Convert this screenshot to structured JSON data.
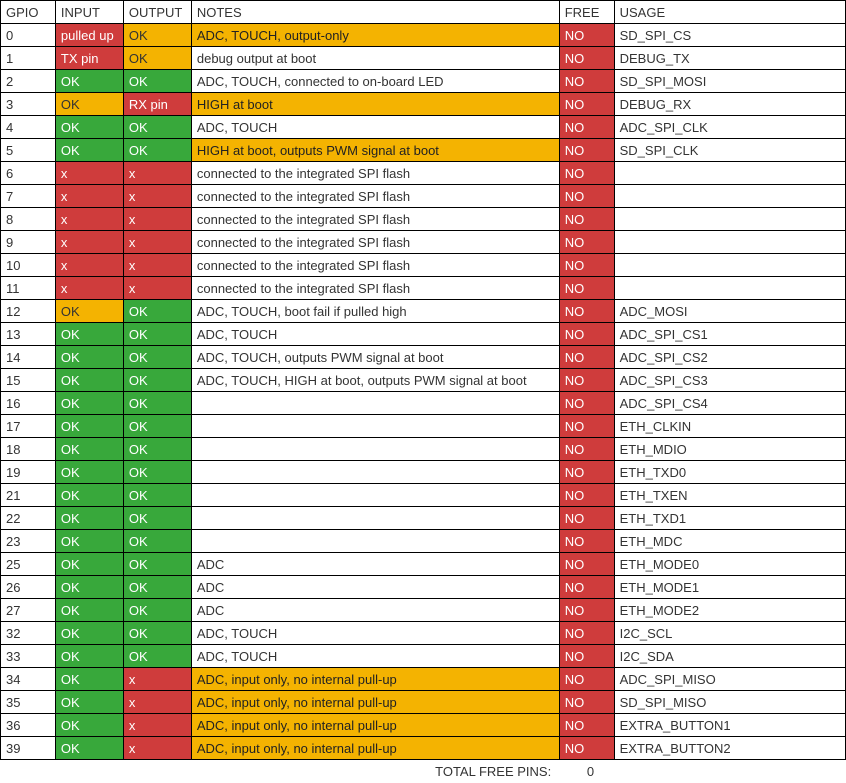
{
  "headers": {
    "gpio": "GPIO",
    "input": "INPUT",
    "output": "OUTPUT",
    "notes": "NOTES",
    "free": "FREE",
    "usage": "USAGE"
  },
  "rows": [
    {
      "gpio": "0",
      "input": "pulled up",
      "input_c": "red",
      "output": "OK",
      "output_c": "yellow",
      "notes": "ADC, TOUCH, output-only",
      "notes_c": "yellow-dk",
      "free": "NO",
      "free_c": "red",
      "usage": "SD_SPI_CS"
    },
    {
      "gpio": "1",
      "input": "TX pin",
      "input_c": "red",
      "output": "OK",
      "output_c": "yellow",
      "notes": "debug output at boot",
      "notes_c": "",
      "free": "NO",
      "free_c": "red",
      "usage": "DEBUG_TX"
    },
    {
      "gpio": "2",
      "input": "OK",
      "input_c": "green",
      "output": "OK",
      "output_c": "green",
      "notes": "ADC, TOUCH, connected to on-board LED",
      "notes_c": "",
      "free": "NO",
      "free_c": "red",
      "usage": "SD_SPI_MOSI"
    },
    {
      "gpio": "3",
      "input": "OK",
      "input_c": "yellow",
      "output": "RX pin",
      "output_c": "red",
      "notes": "HIGH at boot",
      "notes_c": "yellow-dk",
      "free": "NO",
      "free_c": "red",
      "usage": "DEBUG_RX"
    },
    {
      "gpio": "4",
      "input": "OK",
      "input_c": "green",
      "output": "OK",
      "output_c": "green",
      "notes": "ADC, TOUCH",
      "notes_c": "",
      "free": "NO",
      "free_c": "red",
      "usage": "ADC_SPI_CLK"
    },
    {
      "gpio": "5",
      "input": "OK",
      "input_c": "green",
      "output": "OK",
      "output_c": "green",
      "notes": "HIGH at boot, outputs PWM signal at boot",
      "notes_c": "yellow-dk",
      "free": "NO",
      "free_c": "red",
      "usage": "SD_SPI_CLK"
    },
    {
      "gpio": "6",
      "input": "x",
      "input_c": "red",
      "output": "x",
      "output_c": "red",
      "notes": "connected to the integrated SPI flash",
      "notes_c": "",
      "free": "NO",
      "free_c": "red",
      "usage": ""
    },
    {
      "gpio": "7",
      "input": "x",
      "input_c": "red",
      "output": "x",
      "output_c": "red",
      "notes": "connected to the integrated SPI flash",
      "notes_c": "",
      "free": "NO",
      "free_c": "red",
      "usage": ""
    },
    {
      "gpio": "8",
      "input": "x",
      "input_c": "red",
      "output": "x",
      "output_c": "red",
      "notes": "connected to the integrated SPI flash",
      "notes_c": "",
      "free": "NO",
      "free_c": "red",
      "usage": ""
    },
    {
      "gpio": "9",
      "input": "x",
      "input_c": "red",
      "output": "x",
      "output_c": "red",
      "notes": "connected to the integrated SPI flash",
      "notes_c": "",
      "free": "NO",
      "free_c": "red",
      "usage": ""
    },
    {
      "gpio": "10",
      "input": "x",
      "input_c": "red",
      "output": "x",
      "output_c": "red",
      "notes": "connected to the integrated SPI flash",
      "notes_c": "",
      "free": "NO",
      "free_c": "red",
      "usage": ""
    },
    {
      "gpio": "11",
      "input": "x",
      "input_c": "red",
      "output": "x",
      "output_c": "red",
      "notes": "connected to the integrated SPI flash",
      "notes_c": "",
      "free": "NO",
      "free_c": "red",
      "usage": ""
    },
    {
      "gpio": "12",
      "input": "OK",
      "input_c": "yellow",
      "output": "OK",
      "output_c": "green",
      "notes": "ADC, TOUCH, boot fail if pulled high",
      "notes_c": "",
      "free": "NO",
      "free_c": "red",
      "usage": "ADC_MOSI"
    },
    {
      "gpio": "13",
      "input": "OK",
      "input_c": "green",
      "output": "OK",
      "output_c": "green",
      "notes": "ADC, TOUCH",
      "notes_c": "",
      "free": "NO",
      "free_c": "red",
      "usage": "ADC_SPI_CS1"
    },
    {
      "gpio": "14",
      "input": "OK",
      "input_c": "green",
      "output": "OK",
      "output_c": "green",
      "notes": "ADC, TOUCH, outputs PWM signal at boot",
      "notes_c": "",
      "free": "NO",
      "free_c": "red",
      "usage": "ADC_SPI_CS2"
    },
    {
      "gpio": "15",
      "input": "OK",
      "input_c": "green",
      "output": "OK",
      "output_c": "green",
      "notes": "ADC, TOUCH, HIGH at boot, outputs PWM signal at boot",
      "notes_c": "",
      "free": "NO",
      "free_c": "red",
      "usage": "ADC_SPI_CS3"
    },
    {
      "gpio": "16",
      "input": "OK",
      "input_c": "green",
      "output": "OK",
      "output_c": "green",
      "notes": "",
      "notes_c": "",
      "free": "NO",
      "free_c": "red",
      "usage": "ADC_SPI_CS4"
    },
    {
      "gpio": "17",
      "input": "OK",
      "input_c": "green",
      "output": "OK",
      "output_c": "green",
      "notes": "",
      "notes_c": "",
      "free": "NO",
      "free_c": "red",
      "usage": "ETH_CLKIN"
    },
    {
      "gpio": "18",
      "input": "OK",
      "input_c": "green",
      "output": "OK",
      "output_c": "green",
      "notes": "",
      "notes_c": "",
      "free": "NO",
      "free_c": "red",
      "usage": "ETH_MDIO"
    },
    {
      "gpio": "19",
      "input": "OK",
      "input_c": "green",
      "output": "OK",
      "output_c": "green",
      "notes": "",
      "notes_c": "",
      "free": "NO",
      "free_c": "red",
      "usage": "ETH_TXD0"
    },
    {
      "gpio": "21",
      "input": "OK",
      "input_c": "green",
      "output": "OK",
      "output_c": "green",
      "notes": "",
      "notes_c": "",
      "free": "NO",
      "free_c": "red",
      "usage": "ETH_TXEN"
    },
    {
      "gpio": "22",
      "input": "OK",
      "input_c": "green",
      "output": "OK",
      "output_c": "green",
      "notes": "",
      "notes_c": "",
      "free": "NO",
      "free_c": "red",
      "usage": "ETH_TXD1"
    },
    {
      "gpio": "23",
      "input": "OK",
      "input_c": "green",
      "output": "OK",
      "output_c": "green",
      "notes": "",
      "notes_c": "",
      "free": "NO",
      "free_c": "red",
      "usage": "ETH_MDC"
    },
    {
      "gpio": "25",
      "input": "OK",
      "input_c": "green",
      "output": "OK",
      "output_c": "green",
      "notes": "ADC",
      "notes_c": "",
      "free": "NO",
      "free_c": "red",
      "usage": "ETH_MODE0"
    },
    {
      "gpio": "26",
      "input": "OK",
      "input_c": "green",
      "output": "OK",
      "output_c": "green",
      "notes": "ADC",
      "notes_c": "",
      "free": "NO",
      "free_c": "red",
      "usage": "ETH_MODE1"
    },
    {
      "gpio": "27",
      "input": "OK",
      "input_c": "green",
      "output": "OK",
      "output_c": "green",
      "notes": "ADC",
      "notes_c": "",
      "free": "NO",
      "free_c": "red",
      "usage": "ETH_MODE2"
    },
    {
      "gpio": "32",
      "input": "OK",
      "input_c": "green",
      "output": "OK",
      "output_c": "green",
      "notes": "ADC, TOUCH",
      "notes_c": "",
      "free": "NO",
      "free_c": "red",
      "usage": "I2C_SCL"
    },
    {
      "gpio": "33",
      "input": "OK",
      "input_c": "green",
      "output": "OK",
      "output_c": "green",
      "notes": "ADC, TOUCH",
      "notes_c": "",
      "free": "NO",
      "free_c": "red",
      "usage": "I2C_SDA"
    },
    {
      "gpio": "34",
      "input": "OK",
      "input_c": "green",
      "output": "x",
      "output_c": "red",
      "notes": "ADC, input only, no internal pull-up",
      "notes_c": "yellow-dk",
      "free": "NO",
      "free_c": "red",
      "usage": "ADC_SPI_MISO"
    },
    {
      "gpio": "35",
      "input": "OK",
      "input_c": "green",
      "output": "x",
      "output_c": "red",
      "notes": "ADC, input only, no internal pull-up",
      "notes_c": "yellow-dk",
      "free": "NO",
      "free_c": "red",
      "usage": "SD_SPI_MISO"
    },
    {
      "gpio": "36",
      "input": "OK",
      "input_c": "green",
      "output": "x",
      "output_c": "red",
      "notes": "ADC, input only, no internal pull-up",
      "notes_c": "yellow-dk",
      "free": "NO",
      "free_c": "red",
      "usage": "EXTRA_BUTTON1"
    },
    {
      "gpio": "39",
      "input": "OK",
      "input_c": "green",
      "output": "x",
      "output_c": "red",
      "notes": "ADC, input only, no internal pull-up",
      "notes_c": "yellow-dk",
      "free": "NO",
      "free_c": "red",
      "usage": "EXTRA_BUTTON2"
    }
  ],
  "total": {
    "label": "TOTAL FREE PINS:",
    "value": "0"
  }
}
